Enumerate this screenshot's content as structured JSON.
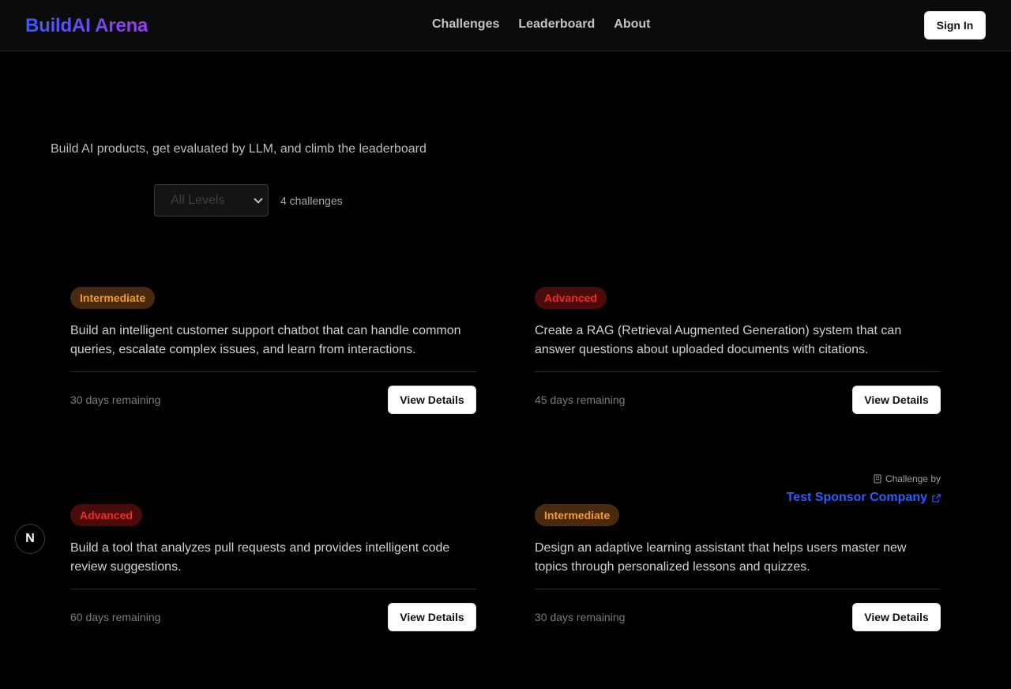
{
  "header": {
    "brand": "BuildAI Arena",
    "nav": [
      "Challenges",
      "Leaderboard",
      "About"
    ],
    "sign_in": "Sign In"
  },
  "hero": {
    "subtitle": "Build AI products, get evaluated by LLM, and climb the leaderboard"
  },
  "filters": {
    "level_selected": "All Levels",
    "count_text": "4 challenges"
  },
  "challenges": [
    {
      "level": "Intermediate",
      "description": "Build an intelligent customer support chatbot that can handle common queries, escalate complex issues, and learn from interactions.",
      "remaining": "30 days remaining",
      "button": "View Details"
    },
    {
      "level": "Advanced",
      "description": "Create a RAG (Retrieval Augmented Generation) system that can answer questions about uploaded documents with citations.",
      "remaining": "45 days remaining",
      "button": "View Details"
    },
    {
      "level": "Advanced",
      "description": "Build a tool that analyzes pull requests and provides intelligent code review suggestions.",
      "remaining": "60 days remaining",
      "button": "View Details"
    },
    {
      "level": "Intermediate",
      "description": "Design an adaptive learning assistant that helps users master new topics through personalized lessons and quizzes.",
      "remaining": "30 days remaining",
      "button": "View Details",
      "sponsor_label": "Challenge by",
      "sponsor_name": "Test Sponsor Company"
    }
  ],
  "dev_badge": "N",
  "colors": {
    "background": "#000000",
    "intermediate_bg": "#4a2a0e",
    "intermediate_text": "#f39a2e",
    "advanced_bg": "#4a0b0b",
    "advanced_text": "#f02a2a",
    "sponsor_link": "#2d5cff"
  }
}
